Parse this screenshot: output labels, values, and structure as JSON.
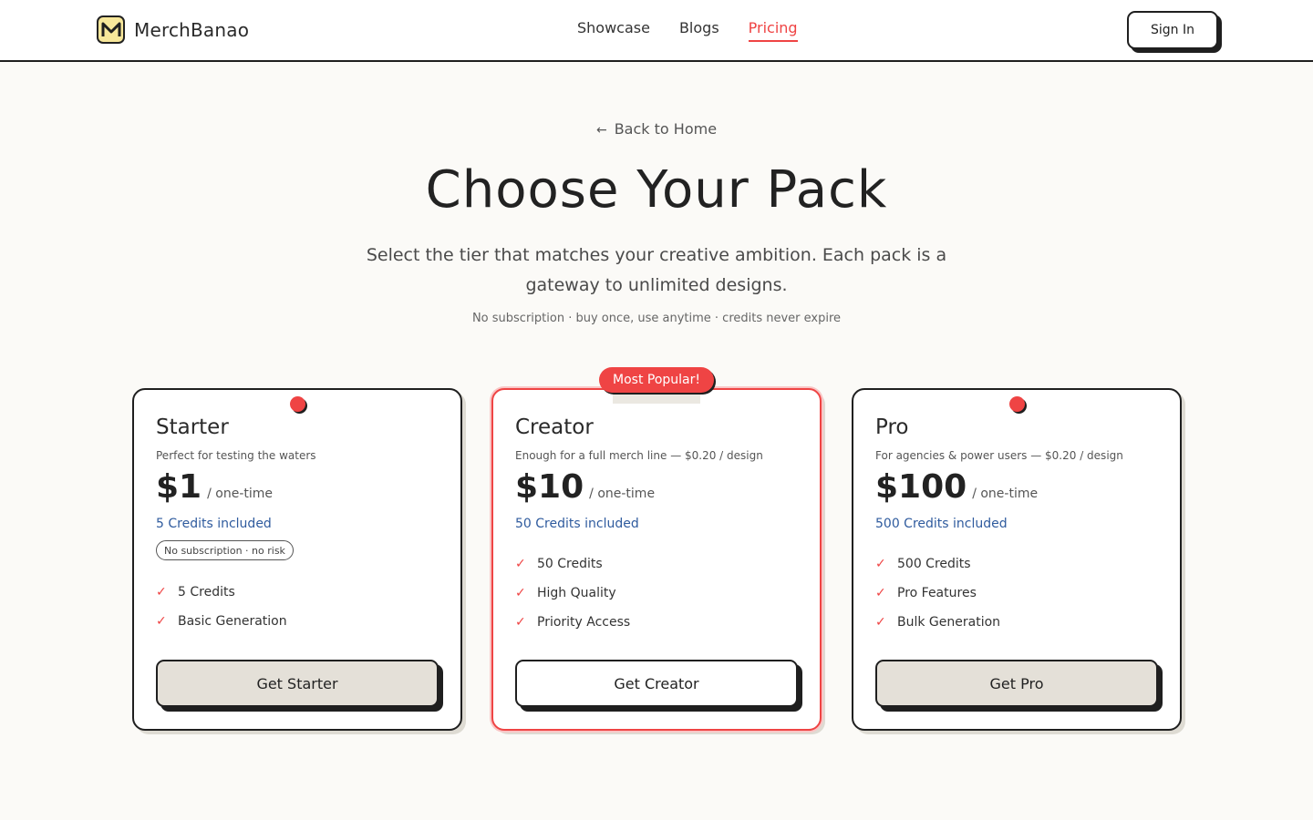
{
  "header": {
    "brand": "MerchBanao",
    "logo_letter": "M",
    "nav": [
      {
        "label": "Showcase",
        "active": false
      },
      {
        "label": "Blogs",
        "active": false
      },
      {
        "label": "Pricing",
        "active": true
      }
    ],
    "signin_label": "Sign In"
  },
  "hero": {
    "back_label": "Back to Home",
    "back_icon": "arrow-left-icon",
    "title": "Choose Your Pack",
    "subtitle": "Select the tier that matches your creative ambition. Each pack is a gateway to unlimited designs.",
    "note": "No subscription · buy once, use anytime · credits never expire"
  },
  "featured_badge": "Most Popular!",
  "plans": [
    {
      "name": "Starter",
      "desc": "Perfect for testing the waters",
      "price": "$1",
      "period": "/ one-time",
      "credits": "5 Credits included",
      "pill": "No subscription · no risk",
      "features": [
        "5 Credits",
        "Basic Generation"
      ],
      "cta": "Get Starter"
    },
    {
      "name": "Creator",
      "desc": "Enough for a full merch line — $0.20 / design",
      "price": "$10",
      "period": "/ one-time",
      "credits": "50 Credits included",
      "features": [
        "50 Credits",
        "High Quality",
        "Priority Access"
      ],
      "cta": "Get Creator"
    },
    {
      "name": "Pro",
      "desc": "For agencies & power users — $0.20 / design",
      "price": "$100",
      "period": "/ one-time",
      "credits": "500 Credits included",
      "features": [
        "500 Credits",
        "Pro Features",
        "Bulk Generation"
      ],
      "cta": "Get Pro"
    }
  ],
  "colors": {
    "accent": "#ef4444",
    "credits": "#2f5b9e",
    "background": "#fbfaf7",
    "cta_fill": "#e4e0d8",
    "logo_fill": "#f7e79a"
  }
}
